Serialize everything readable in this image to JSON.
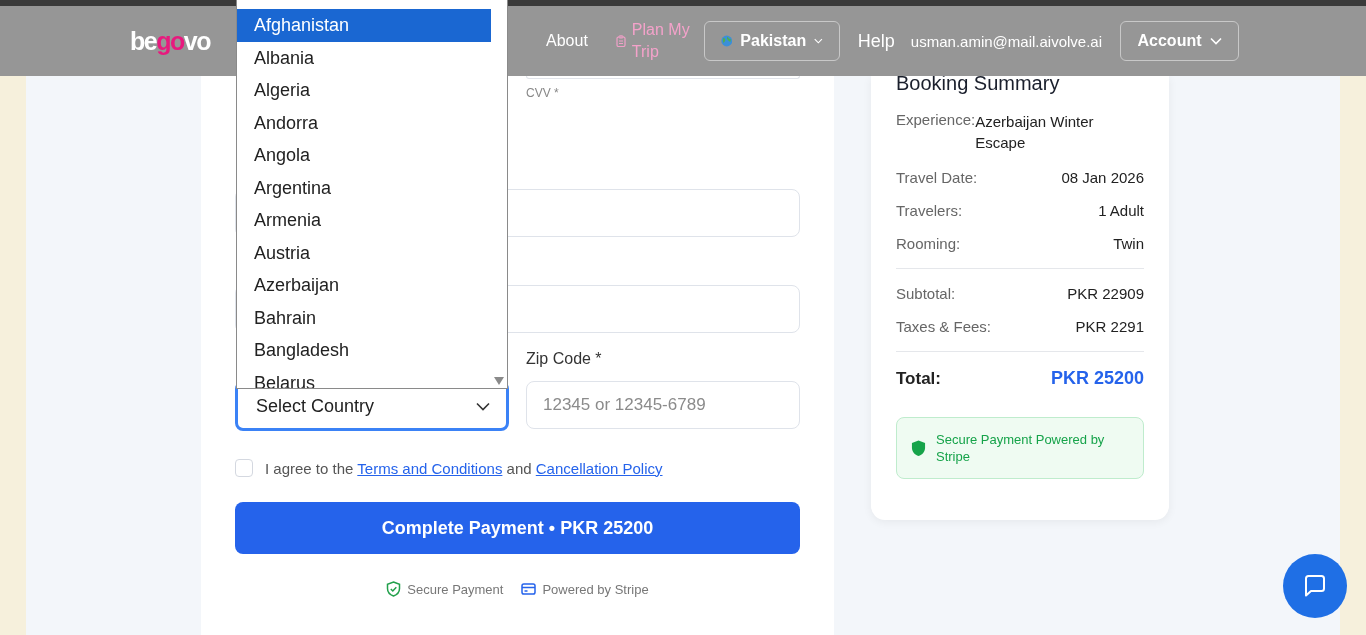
{
  "nav": {
    "logo": [
      {
        "text": "be",
        "accent": false
      },
      {
        "text": "go",
        "accent": true
      },
      {
        "text": "vo",
        "accent": false
      }
    ],
    "links": [
      {
        "kind": "link",
        "label": "About"
      },
      {
        "kind": "plan",
        "label": "Plan My Trip"
      },
      {
        "kind": "region",
        "label": "Pakistan"
      },
      {
        "kind": "link",
        "label": "Help"
      },
      {
        "kind": "email",
        "label": "usman.amin@mail.aivolve.ai"
      },
      {
        "kind": "account",
        "label": "Account"
      }
    ]
  },
  "form": {
    "cvv_label": "CVV *",
    "country": {
      "value": "Select Country",
      "expanded": true
    },
    "country_options": [
      {
        "label": "Afghanistan",
        "selected": true
      },
      {
        "label": "Albania",
        "selected": false
      },
      {
        "label": "Algeria",
        "selected": false
      },
      {
        "label": "Andorra",
        "selected": false
      },
      {
        "label": "Angola",
        "selected": false
      },
      {
        "label": "Argentina",
        "selected": false
      },
      {
        "label": "Armenia",
        "selected": false
      },
      {
        "label": "Austria",
        "selected": false
      },
      {
        "label": "Azerbaijan",
        "selected": false
      },
      {
        "label": "Bahrain",
        "selected": false
      },
      {
        "label": "Bangladesh",
        "selected": false
      },
      {
        "label": "Belarus",
        "selected": false
      }
    ],
    "zip": {
      "label": "Zip Code *",
      "placeholder": "12345 or 12345-6789"
    },
    "agreement": {
      "checked": false,
      "parts": [
        {
          "kind": "text",
          "text": "I agree to the"
        },
        {
          "kind": "link",
          "text": "Terms and Conditions"
        },
        {
          "kind": "text",
          "text": "and"
        },
        {
          "kind": "link",
          "text": "Cancellation Policy"
        }
      ]
    },
    "pay_button": "Complete Payment • PKR 25200",
    "badges": [
      {
        "kind": "shield",
        "text": "Secure Payment"
      },
      {
        "kind": "card",
        "text": "Powered by Stripe"
      }
    ]
  },
  "summary": {
    "title": "Booking Summary",
    "details": [
      {
        "label": "Experience:",
        "value": "Azerbaijan Winter Escape",
        "kind": "stacked"
      },
      {
        "label": "Travel Date:",
        "value": "08 Jan 2026",
        "kind": "row"
      },
      {
        "label": "Travelers:",
        "value": "1 Adult",
        "kind": "row"
      },
      {
        "label": "Rooming:",
        "value": "Twin",
        "kind": "row"
      }
    ],
    "charges": [
      {
        "label": "Subtotal:",
        "value": "PKR 22909"
      },
      {
        "label": "Taxes & Fees:",
        "value": "PKR 2291"
      }
    ],
    "total": {
      "label": "Total:",
      "value": "PKR 25200"
    },
    "notice": "Secure Payment Powered by Stripe"
  }
}
